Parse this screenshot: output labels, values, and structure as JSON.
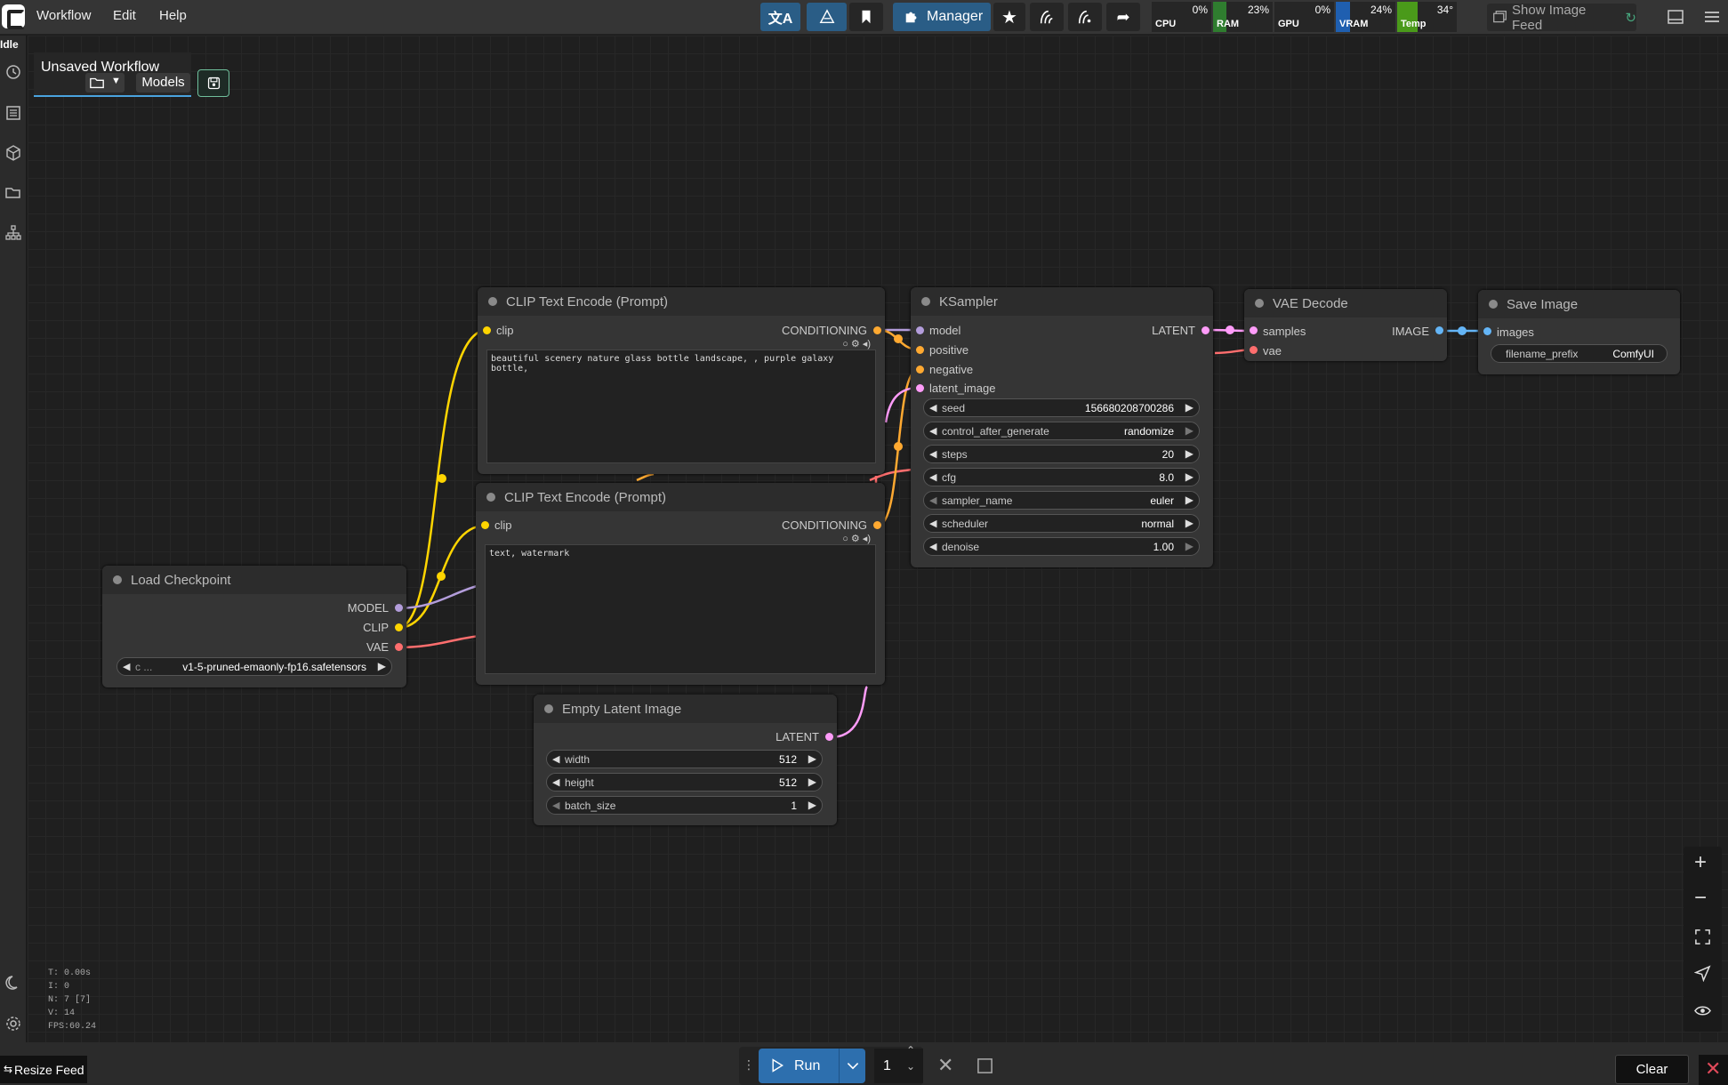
{
  "menu": {
    "workflow": "Workflow",
    "edit": "Edit",
    "help": "Help"
  },
  "toolbar": {
    "manager_label": "Manager"
  },
  "monitors": [
    {
      "label": "CPU",
      "percent": "0%",
      "fill": 0.0,
      "color": "#2f7d2f"
    },
    {
      "label": "RAM",
      "percent": "23%",
      "fill": 0.23,
      "color": "#2f7d2f"
    },
    {
      "label": "GPU",
      "percent": "0%",
      "fill": 0.0,
      "color": "#2f7d2f"
    },
    {
      "label": "VRAM",
      "percent": "24%",
      "fill": 0.24,
      "color": "#1f5fb0"
    },
    {
      "label": "Temp",
      "percent": "34°",
      "fill": 0.34,
      "color": "#4a9a1a"
    }
  ],
  "image_feed_label": "Show Image Feed",
  "status": "Idle",
  "workflow_tab": {
    "title": "Unsaved Workflow",
    "models_label": "Models"
  },
  "nodes": {
    "clip_pos": {
      "title": "CLIP Text Encode (Prompt)",
      "input": "clip",
      "output": "CONDITIONING",
      "text": "beautiful scenery nature glass bottle landscape, , purple galaxy bottle,"
    },
    "clip_neg": {
      "title": "CLIP Text Encode (Prompt)",
      "input": "clip",
      "output": "CONDITIONING",
      "text": "text, watermark"
    },
    "ksampler": {
      "title": "KSampler",
      "inputs": [
        "model",
        "positive",
        "negative",
        "latent_image"
      ],
      "output": "LATENT",
      "widgets": [
        {
          "label": "seed",
          "value": "156680208700286"
        },
        {
          "label": "control_after_generate",
          "value": "randomize"
        },
        {
          "label": "steps",
          "value": "20"
        },
        {
          "label": "cfg",
          "value": "8.0"
        },
        {
          "label": "sampler_name",
          "value": "euler"
        },
        {
          "label": "scheduler",
          "value": "normal"
        },
        {
          "label": "denoise",
          "value": "1.00"
        }
      ]
    },
    "vae_decode": {
      "title": "VAE Decode",
      "inputs": [
        "samples",
        "vae"
      ],
      "output": "IMAGE"
    },
    "save_image": {
      "title": "Save Image",
      "input": "images",
      "widget_label": "filename_prefix",
      "widget_value": "ComfyUI"
    },
    "load_checkpoint": {
      "title": "Load Checkpoint",
      "outputs": [
        "MODEL",
        "CLIP",
        "VAE"
      ],
      "widget_prefix": "c ...",
      "widget_value": "v1-5-pruned-emaonly-fp16.safetensors"
    },
    "empty_latent": {
      "title": "Empty Latent Image",
      "output": "LATENT",
      "widgets": [
        {
          "label": "width",
          "value": "512"
        },
        {
          "label": "height",
          "value": "512"
        },
        {
          "label": "batch_size",
          "value": "1"
        }
      ]
    }
  },
  "stats": [
    "T: 0.00s",
    "I: 0",
    "N: 7 [7]",
    "V: 14",
    "FPS:60.24"
  ],
  "bottom": {
    "resize_feed": "Resize Feed",
    "run_label": "Run",
    "run_count": "1",
    "clear_label": "Clear"
  },
  "colors": {
    "clip": "#ffd500",
    "model": "#b39ddb",
    "vae": "#ff6e6e",
    "conditioning": "#ffa931",
    "latent": "#ff9cf9",
    "image": "#64b5f6"
  }
}
